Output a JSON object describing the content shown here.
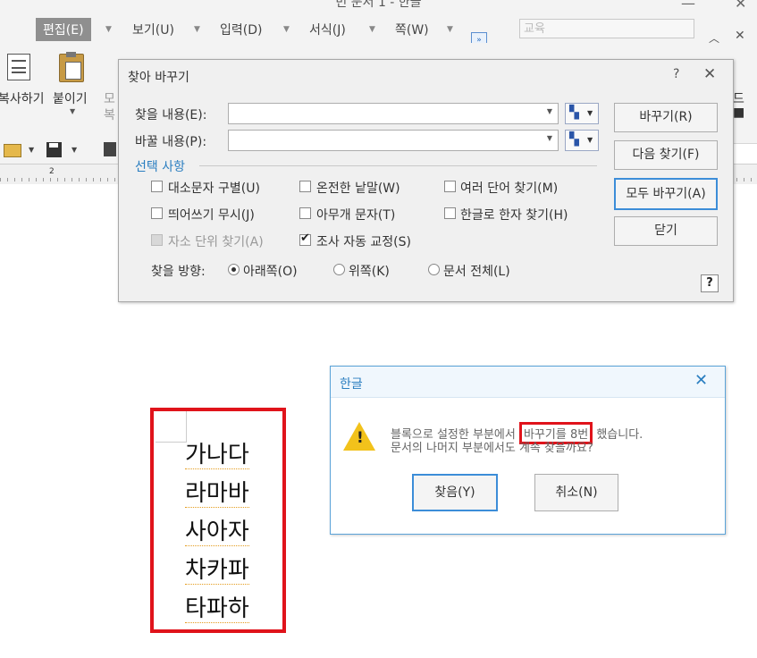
{
  "window": {
    "title": "빈 문서 1 - 한글"
  },
  "menu": {
    "items": [
      {
        "label": "편집(E)"
      },
      {
        "label": "보기(U)"
      },
      {
        "label": "입력(D)"
      },
      {
        "label": "서식(J)"
      },
      {
        "label": "쪽(W)"
      }
    ],
    "font_value": "교육"
  },
  "ribbon": {
    "copy_label": "복사하기",
    "paste_label": "붙이기",
    "shape_label_1": "모",
    "shape_label_2": "복"
  },
  "ruler": {
    "mark": "2"
  },
  "find_dialog": {
    "title": "찾아 바꾸기",
    "find_label": "찾을 내용(E):",
    "find_value": "",
    "replace_label": "바꿀 내용(P):",
    "replace_value": "",
    "section_title": "선택 사항",
    "options": {
      "match_case": "대소문자 구별(U)",
      "whole_word": "온전한 낱말(W)",
      "multi_word": "여러 단어 찾기(M)",
      "ignore_space": "띄어쓰기 무시(J)",
      "any_char": "아무개 문자(T)",
      "hangul_hanja": "한글로 한자 찾기(H)",
      "jaso": "자소 단위 찾기(A)",
      "josa": "조사 자동 교정(S)"
    },
    "direction_label": "찾을 방향:",
    "directions": {
      "down": "아래쪽(O)",
      "up": "위쪽(K)",
      "all": "문서 전체(L)"
    },
    "buttons": {
      "replace": "바꾸기(R)",
      "find_next": "다음 찾기(F)",
      "replace_all": "모두 바꾸기(A)",
      "close": "닫기"
    }
  },
  "alert": {
    "title": "한글",
    "line1_pre": "블록으로 설정한 부분에서",
    "line1_highlight": "바꾸기를 8번",
    "line1_post": "했습니다.",
    "line2": "문서의 나머지 부분에서도 계속 찾을까요?",
    "yes": "찾음(Y)",
    "no": "취소(N)"
  },
  "document": {
    "lines": [
      "가나다",
      "라마바",
      "사아자",
      "차카파",
      "타파하"
    ]
  },
  "colors": {
    "accent": "#2a7ec0",
    "highlight": "#e0131b",
    "ribbon_bg": "#f3f3f3"
  }
}
